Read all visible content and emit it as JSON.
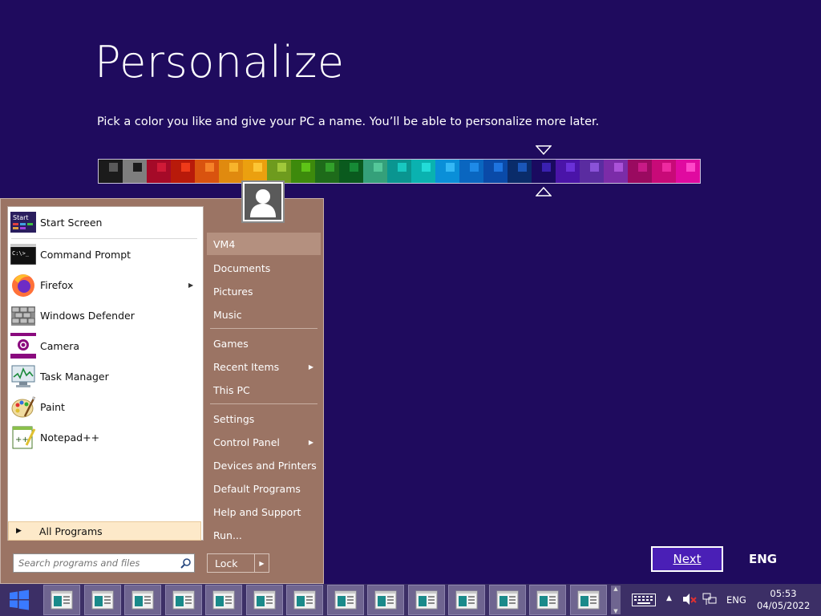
{
  "page": {
    "title": "Personalize",
    "subtitle": "Pick a color you like and give your PC a name. You’ll be able to personalize more later.",
    "next_label": "Next",
    "language": "ENG"
  },
  "palette": {
    "selected_index": 18,
    "swatches": [
      {
        "bg": "#1b1b1b",
        "dot": "#5a5a5a"
      },
      {
        "bg": "#7e7e7e",
        "dot": "#1b1b1b"
      },
      {
        "bg": "#a50a28",
        "dot": "#d01a37"
      },
      {
        "bg": "#b81a0a",
        "dot": "#ef3a19"
      },
      {
        "bg": "#d9530f",
        "dot": "#f58228"
      },
      {
        "bg": "#e08a0f",
        "dot": "#f7b42b"
      },
      {
        "bg": "#eba00f",
        "dot": "#fcc635"
      },
      {
        "bg": "#6e9b1e",
        "dot": "#a0c83a"
      },
      {
        "bg": "#3d8a0c",
        "dot": "#5ec417"
      },
      {
        "bg": "#1e6b1a",
        "dot": "#32a02a"
      },
      {
        "bg": "#0a5a1e",
        "dot": "#168a36"
      },
      {
        "bg": "#35a07a",
        "dot": "#55c89a"
      },
      {
        "bg": "#0a9590",
        "dot": "#18c8c0"
      },
      {
        "bg": "#0ab2b0",
        "dot": "#22dcd8"
      },
      {
        "bg": "#0a8fd8",
        "dot": "#34b8f5"
      },
      {
        "bg": "#0a66c0",
        "dot": "#1e8ae8"
      },
      {
        "bg": "#0a4aa8",
        "dot": "#1e74e0"
      },
      {
        "bg": "#0a2c6a",
        "dot": "#1a56b8"
      },
      {
        "bg": "#1a0a60",
        "dot": "#3a20b0"
      },
      {
        "bg": "#4a14a8",
        "dot": "#6a30d8"
      },
      {
        "bg": "#5a2ca0",
        "dot": "#8a52d8"
      },
      {
        "bg": "#7b2ca8",
        "dot": "#aa52d8"
      },
      {
        "bg": "#9a0a60",
        "dot": "#c81a86"
      },
      {
        "bg": "#c80a78",
        "dot": "#ee2aa0"
      },
      {
        "bg": "#e00aa0",
        "dot": "#ff46c8"
      }
    ]
  },
  "start_menu": {
    "programs": [
      {
        "label": "Start Screen",
        "icon": "start-screen-icon"
      },
      {
        "label": "Command Prompt",
        "icon": "command-prompt-icon"
      },
      {
        "label": "Firefox",
        "icon": "firefox-icon",
        "submenu": true
      },
      {
        "label": "Windows Defender",
        "icon": "windows-defender-icon"
      },
      {
        "label": "Camera",
        "icon": "camera-icon"
      },
      {
        "label": "Task Manager",
        "icon": "task-manager-icon"
      },
      {
        "label": "Paint",
        "icon": "paint-icon"
      },
      {
        "label": "Notepad++",
        "icon": "notepad-plus-plus-icon"
      }
    ],
    "start_icon_text": "Start",
    "cmd_icon_text": "C:\\>_",
    "notepad_icon_text": "++",
    "all_programs": "All Programs",
    "search_placeholder": "Search programs and files",
    "right_items": [
      {
        "label": "VM4"
      },
      {
        "label": "Documents"
      },
      {
        "label": "Pictures"
      },
      {
        "label": "Music"
      },
      {
        "label": "Games"
      },
      {
        "label": "Recent Items",
        "submenu": true
      },
      {
        "label": "This PC"
      },
      {
        "label": "Settings"
      },
      {
        "label": "Control Panel",
        "submenu": true
      },
      {
        "label": "Devices and Printers"
      },
      {
        "label": "Default Programs"
      },
      {
        "label": "Help and Support"
      },
      {
        "label": "Run..."
      }
    ],
    "lock_label": "Lock"
  },
  "taskbar": {
    "language": "ENG",
    "time": "05:53",
    "date": "04/05/2022",
    "window_button_count": 14
  },
  "colors": {
    "background": "#1f0b5e",
    "start_menu": "#9b7464",
    "taskbar": "#3c2f66",
    "accent_button": "#4a1fb6"
  }
}
